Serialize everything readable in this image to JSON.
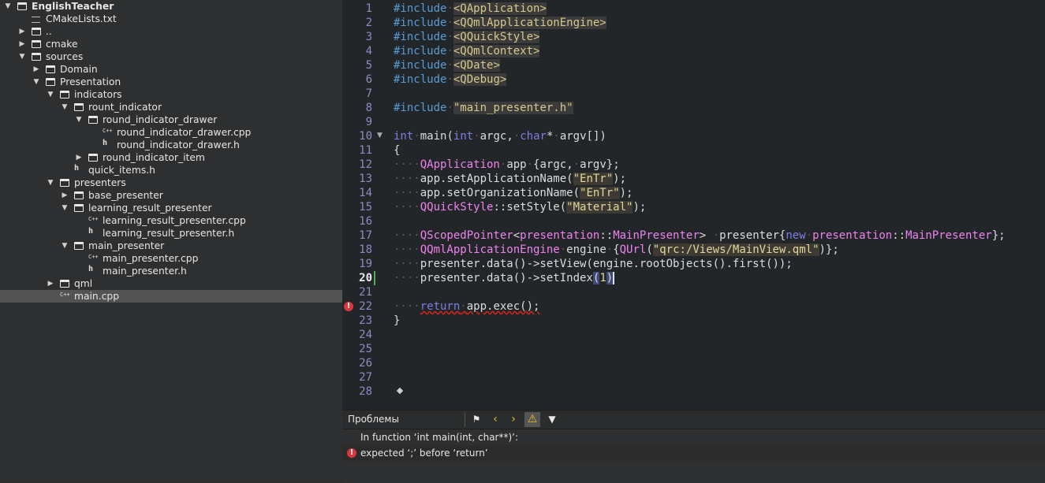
{
  "tree": {
    "items": [
      {
        "label": "EnglishTeacher",
        "type": "folder",
        "depth": 0,
        "expanded": true,
        "root": true
      },
      {
        "label": "CMakeLists.txt",
        "type": "txt",
        "depth": 1
      },
      {
        "label": "..",
        "type": "folder",
        "depth": 1,
        "expanded": false
      },
      {
        "label": "cmake",
        "type": "folder",
        "depth": 1,
        "expanded": false
      },
      {
        "label": "sources",
        "type": "folder",
        "depth": 1,
        "expanded": true
      },
      {
        "label": "Domain",
        "type": "folder",
        "depth": 2,
        "expanded": false
      },
      {
        "label": "Presentation",
        "type": "folder",
        "depth": 2,
        "expanded": true
      },
      {
        "label": "indicators",
        "type": "folder",
        "depth": 3,
        "expanded": true
      },
      {
        "label": "rount_indicator",
        "type": "folder",
        "depth": 4,
        "expanded": true
      },
      {
        "label": "round_indicator_drawer",
        "type": "folder",
        "depth": 5,
        "expanded": true
      },
      {
        "label": "round_indicator_drawer.cpp",
        "type": "cpp",
        "depth": 6
      },
      {
        "label": "round_indicator_drawer.h",
        "type": "h",
        "depth": 6
      },
      {
        "label": "round_indicator_item",
        "type": "folder",
        "depth": 5,
        "expanded": false
      },
      {
        "label": "quick_items.h",
        "type": "h",
        "depth": 4
      },
      {
        "label": "presenters",
        "type": "folder",
        "depth": 3,
        "expanded": true
      },
      {
        "label": "base_presenter",
        "type": "folder",
        "depth": 4,
        "expanded": false
      },
      {
        "label": "learning_result_presenter",
        "type": "folder",
        "depth": 4,
        "expanded": true
      },
      {
        "label": "learning_result_presenter.cpp",
        "type": "cpp",
        "depth": 5
      },
      {
        "label": "learning_result_presenter.h",
        "type": "h",
        "depth": 5
      },
      {
        "label": "main_presenter",
        "type": "folder",
        "depth": 4,
        "expanded": true
      },
      {
        "label": "main_presenter.cpp",
        "type": "cpp",
        "depth": 5
      },
      {
        "label": "main_presenter.h",
        "type": "h",
        "depth": 5
      },
      {
        "label": "qml",
        "type": "folder",
        "depth": 3,
        "expanded": false
      },
      {
        "label": "main.cpp",
        "type": "cpp",
        "depth": 3,
        "selected": true
      }
    ]
  },
  "editor": {
    "current_line": 20,
    "error_line": 22,
    "fold_line": 10,
    "lines": [
      {
        "n": "1",
        "tokens": [
          [
            "pp",
            "#include"
          ],
          [
            "dots",
            "·"
          ],
          [
            "inc",
            "<QApplication>"
          ]
        ]
      },
      {
        "n": "2",
        "tokens": [
          [
            "pp",
            "#include"
          ],
          [
            "dots",
            "·"
          ],
          [
            "inc",
            "<QQmlApplicationEngine>"
          ]
        ]
      },
      {
        "n": "3",
        "tokens": [
          [
            "pp",
            "#include"
          ],
          [
            "dots",
            "·"
          ],
          [
            "inc",
            "<QQuickStyle>"
          ]
        ]
      },
      {
        "n": "4",
        "tokens": [
          [
            "pp",
            "#include"
          ],
          [
            "dots",
            "·"
          ],
          [
            "inc",
            "<QQmlContext>"
          ]
        ]
      },
      {
        "n": "5",
        "tokens": [
          [
            "pp",
            "#include"
          ],
          [
            "dots",
            "·"
          ],
          [
            "inc",
            "<QDate>"
          ]
        ]
      },
      {
        "n": "6",
        "tokens": [
          [
            "pp",
            "#include"
          ],
          [
            "dots",
            "·"
          ],
          [
            "inc",
            "<QDebug>"
          ]
        ]
      },
      {
        "n": "7",
        "tokens": []
      },
      {
        "n": "8",
        "tokens": [
          [
            "pp",
            "#include"
          ],
          [
            "dots",
            "·"
          ],
          [
            "inc",
            "\"main_presenter.h\""
          ]
        ]
      },
      {
        "n": "9",
        "tokens": []
      },
      {
        "n": "10",
        "tokens": [
          [
            "kw",
            "int"
          ],
          [
            "dots",
            "·"
          ],
          [
            "",
            "main("
          ],
          [
            "kw",
            "int"
          ],
          [
            "dots",
            "·"
          ],
          [
            "",
            "argc,"
          ],
          [
            "dots",
            "·"
          ],
          [
            "kw",
            "char"
          ],
          [
            "",
            "*"
          ],
          [
            "dots",
            "·"
          ],
          [
            "",
            "argv[])"
          ]
        ]
      },
      {
        "n": "11",
        "tokens": [
          [
            "",
            "{"
          ]
        ]
      },
      {
        "n": "12",
        "tokens": [
          [
            "dots",
            "····"
          ],
          [
            "cls",
            "QApplication"
          ],
          [
            "dots",
            "·"
          ],
          [
            "",
            "app"
          ],
          [
            "dots",
            "·"
          ],
          [
            "",
            "{argc,"
          ],
          [
            "dots",
            "·"
          ],
          [
            "",
            "argv};"
          ]
        ]
      },
      {
        "n": "13",
        "tokens": [
          [
            "dots",
            "····"
          ],
          [
            "",
            "app.setApplicationName("
          ],
          [
            "str",
            "\"EnTr\""
          ],
          [
            "",
            ");"
          ]
        ]
      },
      {
        "n": "14",
        "tokens": [
          [
            "dots",
            "····"
          ],
          [
            "",
            "app.setOrganizationName("
          ],
          [
            "str",
            "\"EnTr\""
          ],
          [
            "",
            ");"
          ]
        ]
      },
      {
        "n": "15",
        "tokens": [
          [
            "dots",
            "····"
          ],
          [
            "cls",
            "QQuickStyle"
          ],
          [
            "",
            "::setStyle("
          ],
          [
            "str",
            "\"Material\""
          ],
          [
            "",
            ");"
          ]
        ]
      },
      {
        "n": "16",
        "tokens": []
      },
      {
        "n": "17",
        "tokens": [
          [
            "dots",
            "····"
          ],
          [
            "cls",
            "QScopedPointer"
          ],
          [
            "",
            "<"
          ],
          [
            "cls",
            "presentation"
          ],
          [
            "",
            "::"
          ],
          [
            "cls",
            "MainPresenter"
          ],
          [
            "",
            "> "
          ],
          [
            "dots",
            "·"
          ],
          [
            "",
            "presenter{"
          ],
          [
            "kw",
            "new"
          ],
          [
            "dots",
            "·"
          ],
          [
            "cls",
            "presentation"
          ],
          [
            "",
            "::"
          ],
          [
            "cls",
            "MainPresenter"
          ],
          [
            "",
            "};"
          ]
        ]
      },
      {
        "n": "18",
        "tokens": [
          [
            "dots",
            "····"
          ],
          [
            "cls",
            "QQmlApplicationEngine"
          ],
          [
            "dots",
            "·"
          ],
          [
            "",
            "engine"
          ],
          [
            "dots",
            "·"
          ],
          [
            "",
            "{"
          ],
          [
            "cls",
            "QUrl"
          ],
          [
            "",
            "("
          ],
          [
            "str",
            "\"qrc:/Views/MainView.qml\""
          ],
          [
            "",
            ")};"
          ]
        ]
      },
      {
        "n": "19",
        "tokens": [
          [
            "dots",
            "····"
          ],
          [
            "",
            "presenter.data()->setView(engine.rootObjects().first());"
          ]
        ]
      },
      {
        "n": "20",
        "tokens": [
          [
            "dots",
            "····"
          ],
          [
            "",
            "presenter.data()->setIndex"
          ],
          [
            "bm",
            "("
          ],
          [
            "num",
            "1"
          ],
          [
            "bm",
            ")"
          ],
          [
            "caret",
            ""
          ]
        ]
      },
      {
        "n": "21",
        "tokens": []
      },
      {
        "n": "22",
        "tokens": [
          [
            "dots",
            "····"
          ],
          [
            "kw err",
            "return"
          ],
          [
            "dots err",
            "·"
          ],
          [
            "err",
            "app.exec();"
          ]
        ]
      },
      {
        "n": "23",
        "tokens": [
          [
            "",
            "}"
          ]
        ]
      },
      {
        "n": "24",
        "tokens": []
      },
      {
        "n": "25",
        "tokens": []
      },
      {
        "n": "26",
        "tokens": []
      },
      {
        "n": "27",
        "tokens": []
      },
      {
        "n": "28",
        "tokens": []
      }
    ]
  },
  "issues": {
    "title": "Проблемы",
    "rows": [
      {
        "text": "In function ‘int main(int, char**)’:",
        "icon": ""
      },
      {
        "text": "expected ‘;’ before ‘return’",
        "icon": "error"
      }
    ]
  },
  "colors": {
    "keyword": "#7b7ee6",
    "class": "#ee82ee",
    "string": "#e5d79a",
    "preprocessor": "#569cd6",
    "error": "#d9363e"
  }
}
